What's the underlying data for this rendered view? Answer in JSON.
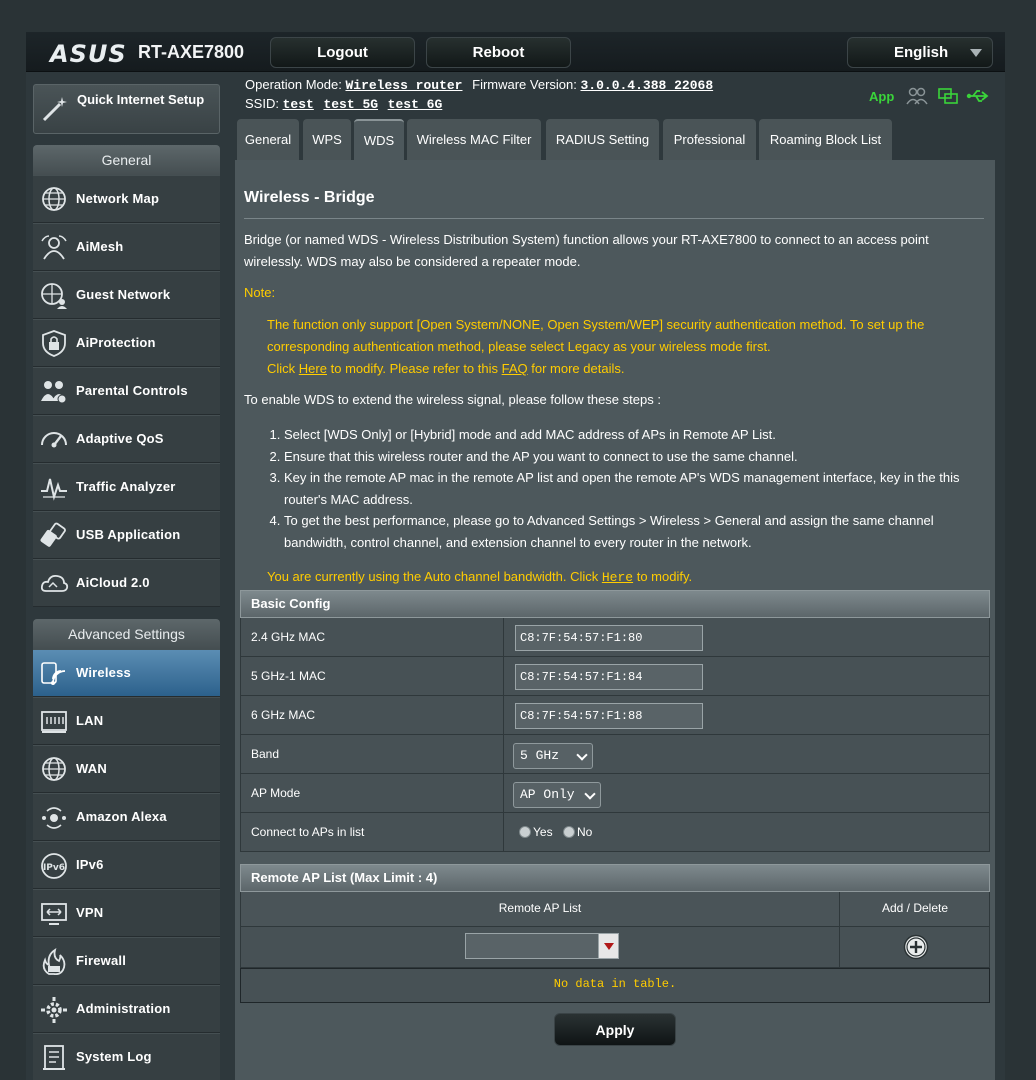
{
  "header": {
    "logo": "ASUS",
    "model": "RT-AXE7800",
    "logout": "Logout",
    "reboot": "Reboot",
    "language": "English",
    "op_mode_label": "Operation Mode:",
    "op_mode_value": "Wireless router",
    "fw_label": "Firmware Version:",
    "fw_value": "3.0.0.4.388_22068",
    "ssid_label": "SSID:",
    "ssids": [
      "test",
      "test_5G",
      "test_6G"
    ],
    "app_label": "App",
    "status_icon_color": "#3ad43a"
  },
  "sidebar": {
    "qis_label": "Quick Internet Setup",
    "general_header": "General",
    "general_items": [
      {
        "label": "Network Map",
        "icon": "globe-icon"
      },
      {
        "label": "AiMesh",
        "icon": "mesh-icon"
      },
      {
        "label": "Guest Network",
        "icon": "globe-users-icon"
      },
      {
        "label": "AiProtection",
        "icon": "shield-lock-icon"
      },
      {
        "label": "Parental Controls",
        "icon": "family-icon"
      },
      {
        "label": "Adaptive QoS",
        "icon": "speedometer-icon"
      },
      {
        "label": "Traffic Analyzer",
        "icon": "pulse-icon"
      },
      {
        "label": "USB Application",
        "icon": "usb-icon"
      },
      {
        "label": "AiCloud 2.0",
        "icon": "cloud-icon"
      }
    ],
    "advanced_header": "Advanced Settings",
    "advanced_items": [
      {
        "label": "Wireless",
        "icon": "wifi-icon",
        "active": true
      },
      {
        "label": "LAN",
        "icon": "lan-icon"
      },
      {
        "label": "WAN",
        "icon": "globe-icon"
      },
      {
        "label": "Amazon Alexa",
        "icon": "alexa-icon"
      },
      {
        "label": "IPv6",
        "icon": "ipv6-icon"
      },
      {
        "label": "VPN",
        "icon": "vpn-icon"
      },
      {
        "label": "Firewall",
        "icon": "fire-icon"
      },
      {
        "label": "Administration",
        "icon": "gear-icon"
      },
      {
        "label": "System Log",
        "icon": "log-icon"
      }
    ]
  },
  "tabs": [
    "General",
    "WPS",
    "WDS",
    "Wireless MAC Filter",
    "RADIUS Setting",
    "Professional",
    "Roaming Block List"
  ],
  "active_tab": "WDS",
  "page": {
    "title": "Wireless - Bridge",
    "intro": "Bridge (or named WDS - Wireless Distribution System) function allows your RT-AXE7800 to connect to an access point wirelessly. WDS may also be considered a repeater mode.",
    "note_label": "Note:",
    "note_text": "The function only support [Open System/NONE, Open System/WEP] security authentication method. To set up the corresponding authentication method, please select Legacy as your wireless mode first.",
    "note_click": "Click",
    "note_here": "Here",
    "note_mid": "to modify. Please refer to this",
    "note_faq": "FAQ",
    "note_end": "for more details.",
    "steps_intro": "To enable WDS to extend the wireless signal, please follow these steps :",
    "steps": [
      "Select [WDS Only] or [Hybrid] mode and add MAC address of APs in Remote AP List.",
      "Ensure that this wireless router and the AP you want to connect to use the same channel.",
      "Key in the remote AP mac in the remote AP list and open the remote AP's WDS management interface, key in the this router's MAC address.",
      "To get the best performance, please go to Advanced Settings > Wireless > General and assign the same channel bandwidth, control channel, and extension channel to every router in the network."
    ],
    "auto_bw_text": "You are currently using the Auto channel bandwidth. Click",
    "auto_bw_here": "Here",
    "auto_bw_end": "to modify."
  },
  "basic_config": {
    "header": "Basic Config",
    "mac_24_label": "2.4 GHz MAC",
    "mac_24": "C8:7F:54:57:F1:80",
    "mac_5_label": "5 GHz-1 MAC",
    "mac_5": "C8:7F:54:57:F1:84",
    "mac_6_label": "6 GHz MAC",
    "mac_6": "C8:7F:54:57:F1:88",
    "band_label": "Band",
    "band_value": "5 GHz",
    "ap_mode_label": "AP Mode",
    "ap_mode_value": "AP Only",
    "connect_label": "Connect to APs in list",
    "yes": "Yes",
    "no": "No"
  },
  "remote_ap": {
    "header": "Remote AP List (Max Limit : 4)",
    "col_list": "Remote AP List",
    "col_action": "Add / Delete",
    "empty": "No data in table."
  },
  "apply": "Apply"
}
